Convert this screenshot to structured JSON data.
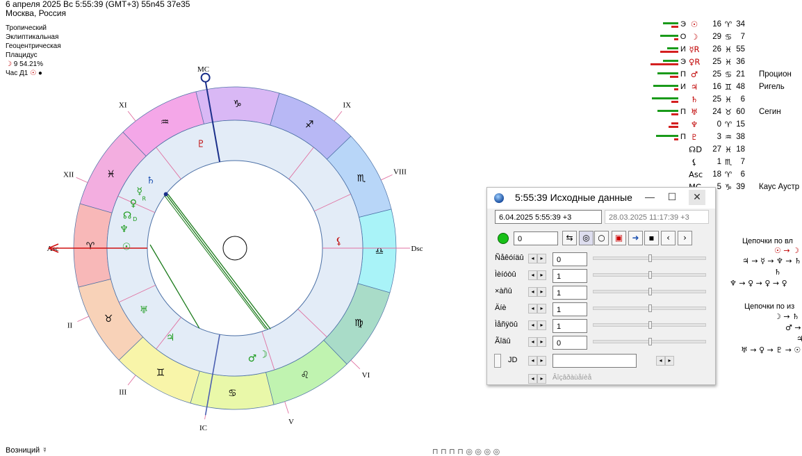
{
  "header": {
    "line1": "6 апреля 2025  Вс   5:55:39 (GMT+3) 55n45  37e35",
    "line2": "Москва, Россия"
  },
  "settings": [
    "Тропический",
    "Эклиптикальная",
    "Геоцентрическая",
    "Плацидус"
  ],
  "moon_phase": "9 54.21%",
  "hour_lord": "Час Д1",
  "chart": {
    "houses": [
      "MC",
      "XI",
      "XII",
      "Asc",
      "II",
      "III",
      "IC",
      "V",
      "VI",
      "Dsc",
      "VIII",
      "IX"
    ],
    "sign_glyphs": [
      "♑",
      "♒",
      "♓",
      "♈",
      "♉",
      "♊",
      "♋",
      "♌",
      "♍",
      "♎",
      "♏",
      "♐"
    ],
    "sign_colors": [
      "#d9b8f5",
      "#f4a7e8",
      "#f3aee0",
      "#f8b8b8",
      "#f8d2b8",
      "#f8f5a9",
      "#e9f8a9",
      "#c0f3b0",
      "#a9dcc8",
      "#a9f3f8",
      "#b8d6f8",
      "#b8b8f5"
    ],
    "inner_glyphs": [
      "♇",
      "♄",
      "☿",
      "♀",
      "☊",
      "♆",
      "☉",
      "♅",
      "♃",
      "♂",
      "☽",
      "⚸"
    ],
    "inner_glyph_labels": [
      "♀R",
      "R",
      "D"
    ]
  },
  "planet_table": [
    {
      "lord": "Э",
      "planet": "☉",
      "deg": "16",
      "sign": "♈",
      "min": "34",
      "star": "",
      "bars": [
        {
          "c": "#1a9a1a",
          "w": 22
        },
        {
          "c": "#d42020",
          "w": 10
        }
      ]
    },
    {
      "lord": "О",
      "planet": "☽",
      "deg": "29",
      "sign": "♋",
      "min": "7",
      "star": "",
      "bars": [
        {
          "c": "#1a9a1a",
          "w": 26
        },
        {
          "c": "#d42020",
          "w": 6
        }
      ]
    },
    {
      "lord": "И",
      "planet": "☿R",
      "deg": "26",
      "sign": "♓",
      "min": "55",
      "star": "",
      "bars": [
        {
          "c": "#1a9a1a",
          "w": 16
        },
        {
          "c": "#d42020",
          "w": 26
        }
      ]
    },
    {
      "lord": "Э",
      "planet": "♀R",
      "deg": "25",
      "sign": "♓",
      "min": "36",
      "star": "",
      "bars": [
        {
          "c": "#1a9a1a",
          "w": 22
        },
        {
          "c": "#d42020",
          "w": 40
        }
      ]
    },
    {
      "lord": "П",
      "planet": "♂",
      "deg": "25",
      "sign": "♋",
      "min": "21",
      "star": "Процион",
      "bars": [
        {
          "c": "#1a9a1a",
          "w": 30
        },
        {
          "c": "#d42020",
          "w": 12
        }
      ]
    },
    {
      "lord": "И",
      "planet": "♃",
      "deg": "16",
      "sign": "♊",
      "min": "48",
      "star": "Ригель",
      "bars": [
        {
          "c": "#1a9a1a",
          "w": 36
        },
        {
          "c": "#d42020",
          "w": 6
        }
      ]
    },
    {
      "lord": "",
      "planet": "♄",
      "deg": "25",
      "sign": "♓",
      "min": "6",
      "star": "",
      "bars": [
        {
          "c": "#1a9a1a",
          "w": 38
        },
        {
          "c": "#d42020",
          "w": 10
        }
      ]
    },
    {
      "lord": "П",
      "planet": "♅",
      "deg": "24",
      "sign": "♉",
      "min": "60",
      "star": "Сегин",
      "bars": [
        {
          "c": "#1a9a1a",
          "w": 30
        },
        {
          "c": "#d42020",
          "w": 10
        }
      ]
    },
    {
      "lord": "",
      "planet": "♆",
      "deg": "0",
      "sign": "♈",
      "min": "15",
      "star": "",
      "bars": [
        {
          "c": "#d42020",
          "w": 10
        },
        {
          "c": "#d42020",
          "w": 14
        }
      ]
    },
    {
      "lord": "П",
      "planet": "♇",
      "deg": "3",
      "sign": "♒",
      "min": "38",
      "star": "",
      "bars": [
        {
          "c": "#1a9a1a",
          "w": 32
        },
        {
          "c": "#d42020",
          "w": 6
        }
      ]
    },
    {
      "lord": "",
      "planet": "☊D",
      "deg": "27",
      "sign": "♓",
      "min": "18",
      "star": "",
      "bars": []
    },
    {
      "lord": "",
      "planet": "⚸",
      "deg": "1",
      "sign": "♏",
      "min": "7",
      "star": "",
      "bars": []
    },
    {
      "lord": "",
      "planet": "Asc",
      "deg": "18",
      "sign": "♈",
      "min": "6",
      "star": "",
      "bars": []
    },
    {
      "lord": "",
      "planet": "MC",
      "deg": "5",
      "sign": "♑",
      "min": "39",
      "star": "Каус Аустр",
      "bars": []
    }
  ],
  "dialog": {
    "title": "5:55:39 Исходные данные",
    "minimize": "—",
    "maximize": "☐",
    "close": "✕",
    "date_field": "6.04.2025   5:55:39  +3",
    "date_field2": "28.03.2025  11:17:39  +3",
    "counter": "0",
    "rows": [
      {
        "label": "Ñåêóíäû",
        "value": "0",
        "thumb": 0.5
      },
      {
        "label": "Ìèíóòû",
        "value": "1",
        "thumb": 0.5
      },
      {
        "label": "×àñû",
        "value": "1",
        "thumb": 0.5
      },
      {
        "label": "Äíè",
        "value": "1",
        "thumb": 0.5
      },
      {
        "label": "Ìåñÿöû",
        "value": "1",
        "thumb": 0.5
      },
      {
        "label": "Ãîäû",
        "value": "0",
        "thumb": 0.5
      }
    ],
    "jd_label": "JD",
    "jd_value": "",
    "footer_text": "Âîçâðàùåíèå"
  },
  "chains": {
    "title1": "Цепочки по вл",
    "line1a": "☉ → ☽",
    "line1b": "♃ → ☿ → ♆ → ♄",
    "line1c": "♄",
    "line1d": "♆ → ♀ → ♀ → ♀",
    "title2": "Цепочки по из",
    "line2a": "☽ → ♄",
    "line2b": "♂ → ☉",
    "line2c": "♃",
    "line2d": "♅ → ♀ → ♇ → ☉ –"
  },
  "footer": {
    "left": "Возниций  ☿",
    "bottom_icons": "⊓ ⊓ ⊓ ⊓   ◎ ◎ ◎ ◎"
  }
}
